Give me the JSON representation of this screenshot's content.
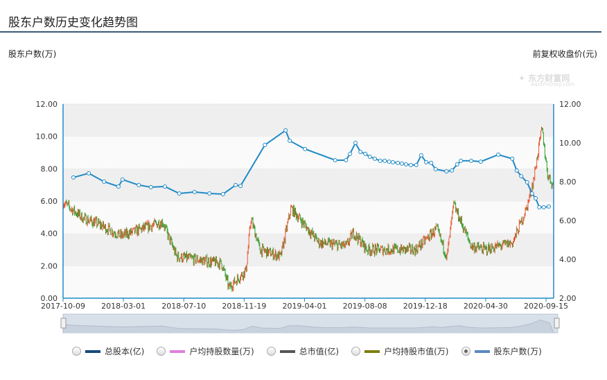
{
  "title": "股东户数历史变化趋势图",
  "watermark": {
    "name": "东方财富网",
    "url_text": "eastmoney.com"
  },
  "legend": [
    {
      "label": "总股本(亿)",
      "color": "#164a7c",
      "selected": false
    },
    {
      "label": "户均持股数量(万)",
      "color": "#dd80dd",
      "selected": false
    },
    {
      "label": "总市值(亿)",
      "color": "#555555",
      "selected": false
    },
    {
      "label": "户均持股市值(万)",
      "color": "#7f7f10",
      "selected": false
    },
    {
      "label": "股东户数(万)",
      "color": "#5b89c0",
      "selected": true
    }
  ],
  "chart_data": {
    "type": "line",
    "title": "股东户数历史变化趋势图",
    "ylabel": "股东户数(万)",
    "y2label": "前复权收盘价(元)",
    "ylim": [
      0,
      12
    ],
    "y2lim": [
      2,
      12
    ],
    "yticks": [
      "0.00",
      "2.00",
      "4.00",
      "6.00",
      "8.00",
      "10.00",
      "12.00"
    ],
    "y2ticks": [
      "2.00",
      "4.00",
      "6.00",
      "8.00",
      "10.00",
      "12.00"
    ],
    "xticks": [
      "2017-10-09",
      "2018-03-01",
      "2018-07-10",
      "2018-11-19",
      "2019-04-01",
      "2019-08-08",
      "2019-12-18",
      "2020-04-30",
      "2020-09-15"
    ],
    "x_unit": "days since 2017-10-09",
    "x_span_days": 1072,
    "series": [
      {
        "name": "股东户数(万)",
        "color": "#1f8ac6",
        "x": [
          23,
          57,
          91,
          123,
          132,
          168,
          195,
          226,
          258,
          292,
          325,
          355,
          383,
          394,
          448,
          494,
          503,
          537,
          604,
          628,
          637,
          649,
          660,
          671,
          681,
          692,
          704,
          714,
          724,
          732,
          743,
          752,
          761,
          772,
          784,
          795,
          806,
          817,
          827,
          851,
          863,
          875,
          883,
          906,
          927,
          966,
          997,
          1007,
          1017,
          1030,
          1041,
          1049,
          1057,
          1067,
          1078
        ],
        "values": [
          7.46,
          7.72,
          7.2,
          6.9,
          7.33,
          6.99,
          6.86,
          6.9,
          6.47,
          6.56,
          6.47,
          6.43,
          6.99,
          6.94,
          9.47,
          10.37,
          9.73,
          9.22,
          8.53,
          8.53,
          8.92,
          9.6,
          9.04,
          8.92,
          8.74,
          8.62,
          8.49,
          8.49,
          8.44,
          8.4,
          8.36,
          8.32,
          8.27,
          8.23,
          8.23,
          8.83,
          8.4,
          8.36,
          7.97,
          7.84,
          7.89,
          8.27,
          8.49,
          8.49,
          8.44,
          8.87,
          8.62,
          7.89,
          7.54,
          7.16,
          6.47,
          6.17,
          5.62,
          5.62,
          5.66
        ]
      },
      {
        "name": "前复权收盘价(元)",
        "type": "candlestick",
        "axis": "right",
        "x": [
          0,
          45,
          75,
          129,
          221,
          252,
          352,
          368,
          406,
          417,
          437,
          483,
          506,
          568,
          629,
          644,
          675,
          783,
          829,
          852,
          867,
          906,
          937,
          998,
          1029,
          1044,
          1063,
          1075,
          1089
        ],
        "values": [
          6.93,
          6.11,
          5.86,
          5.21,
          5.93,
          4.14,
          3.79,
          2.54,
          3.43,
          6.11,
          4.5,
          4.14,
          6.64,
          4.86,
          4.68,
          5.39,
          4.5,
          4.5,
          5.57,
          4.14,
          6.82,
          4.68,
          4.5,
          4.86,
          6.64,
          8.07,
          10.75,
          8.43,
          7.71
        ]
      }
    ]
  }
}
